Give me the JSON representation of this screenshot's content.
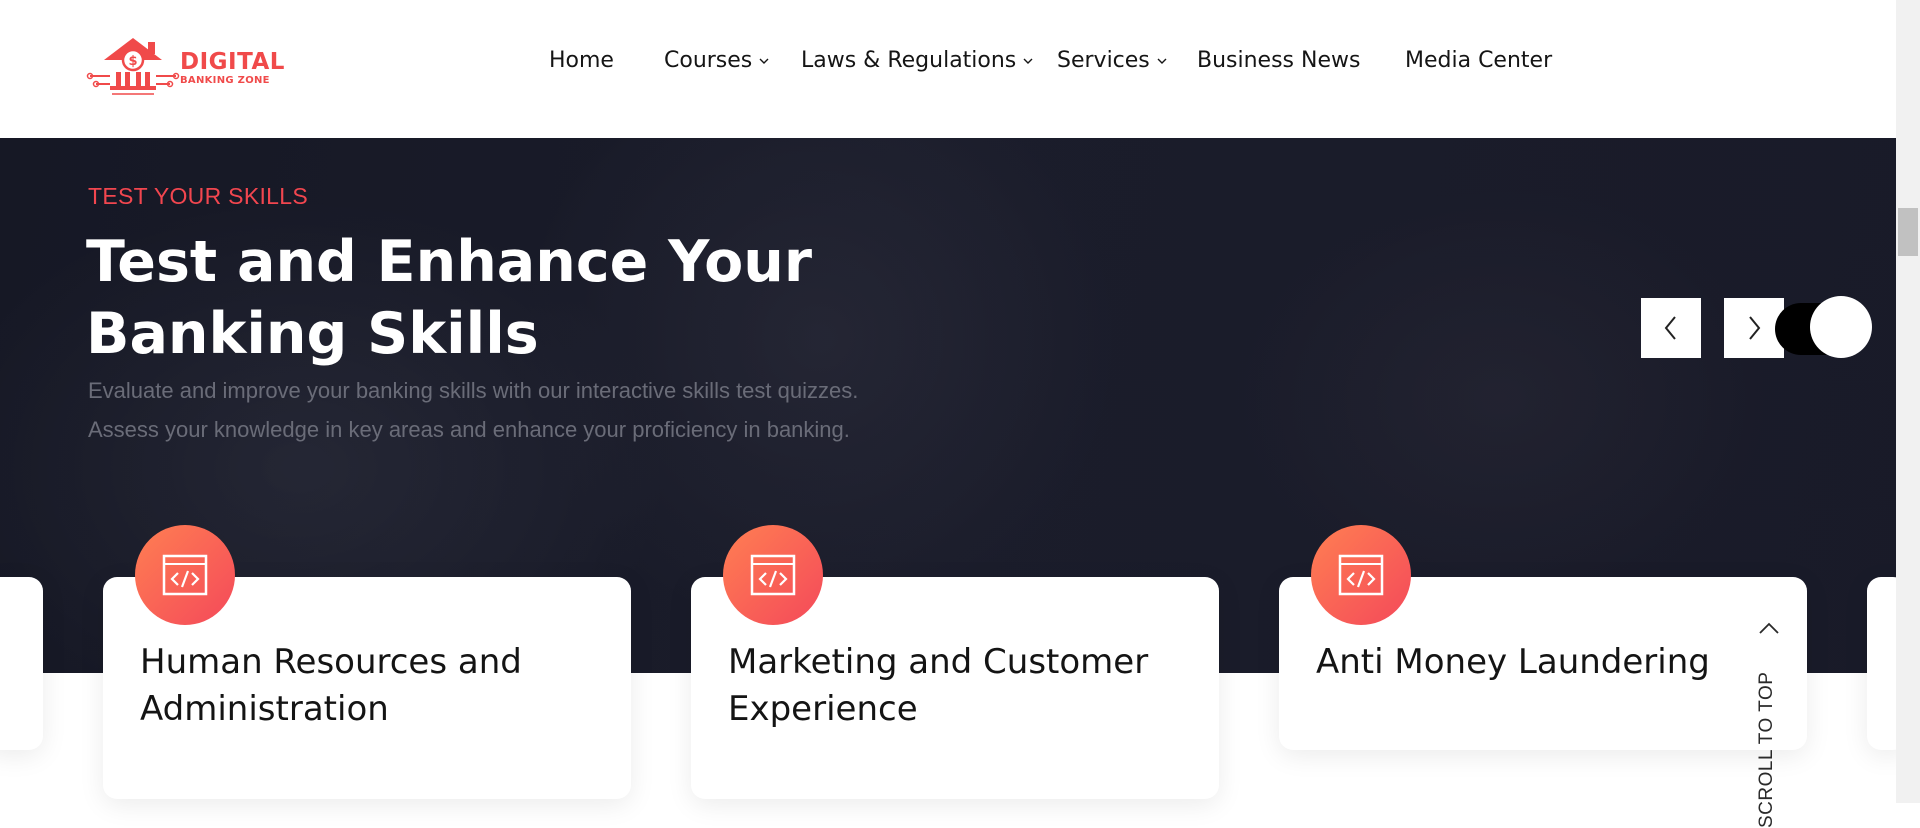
{
  "brand": {
    "line1": "DIGITAL",
    "line2": "BANKING ZONE",
    "logo_icon": "bank-dollar-circuit-icon"
  },
  "nav": {
    "items": [
      {
        "label": "Home",
        "has_dropdown": false
      },
      {
        "label": "Courses",
        "has_dropdown": true
      },
      {
        "label": "Laws & Regulations",
        "has_dropdown": true
      },
      {
        "label": "Services",
        "has_dropdown": true
      },
      {
        "label": "Business News",
        "has_dropdown": false
      },
      {
        "label": "Media Center",
        "has_dropdown": false
      }
    ]
  },
  "hero": {
    "kicker": "TEST YOUR SKILLS",
    "title_line1": "Test and Enhance Your",
    "title_line2": "Banking Skills",
    "desc_line1": "Evaluate and improve your banking skills with our interactive skills test quizzes.",
    "desc_line2": "Assess your knowledge in key areas and enhance your proficiency in banking.",
    "prev_icon": "chevron-left-icon",
    "next_icon": "chevron-right-icon",
    "toggle_state": "on"
  },
  "cards": [
    {
      "title": "Human Resources and Administration",
      "icon": "code-window-icon"
    },
    {
      "title": "Marketing and Customer Experience",
      "icon": "code-window-icon"
    },
    {
      "title": "Anti Money Laundering",
      "icon": "code-window-icon"
    }
  ],
  "scroll_top": {
    "label": "SCROLL TO TOP",
    "icon": "chevron-up-icon"
  },
  "colors": {
    "accent": "#f2464f",
    "icon_gradient_start": "#ff7f52",
    "icon_gradient_end": "#f4495a",
    "hero_bg": "#1c1d2c",
    "text_dark": "#151515"
  }
}
